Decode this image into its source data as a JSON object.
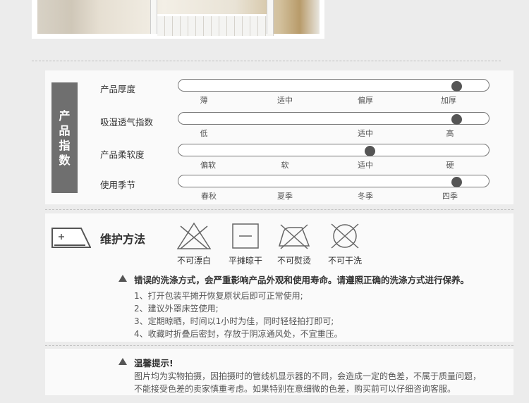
{
  "indices": {
    "sidebar_chars": [
      "产",
      "品",
      "指",
      "数"
    ],
    "rows": [
      {
        "label": "产品厚度",
        "ticks": [
          "薄",
          "适中",
          "偏厚",
          "加厚"
        ],
        "selected": 3,
        "level": 0.88
      },
      {
        "label": "吸湿透气指数",
        "ticks": [
          "低",
          "适中",
          "高"
        ],
        "selected": 2,
        "level": 0.88
      },
      {
        "label": "产品柔软度",
        "ticks": [
          "偏软",
          "软",
          "适中",
          "硬"
        ],
        "selected": 2,
        "level": 0.6
      },
      {
        "label": "使用季节",
        "ticks": [
          "春秋",
          "夏季",
          "冬季",
          "四季"
        ],
        "selected": 3,
        "level": 0.88
      }
    ]
  },
  "care": {
    "title": "维护方法",
    "symbols": [
      {
        "icon": "no-bleach-icon",
        "label": "不可漂白"
      },
      {
        "icon": "dry-flat-icon",
        "label": "平摊晾干"
      },
      {
        "icon": "no-iron-icon",
        "label": "不可熨烫"
      },
      {
        "icon": "no-wash-icon",
        "label": "不可干洗"
      }
    ],
    "warning": "错误的洗涤方式，会严重影响产品外观和使用寿命。请遵照正确的洗涤方式进行保养。",
    "steps": [
      "1、打开包装平摊开恢复原状后即可正常使用;",
      "2、建议外罩床笠使用;",
      "3、定期晾晒，时间以1小时为佳，同时轻轻拍打即可;",
      "4、收藏时折叠后密封，存放于阴凉通风处，不宜重压。"
    ]
  },
  "notice": {
    "title": "温馨提示!",
    "lines": [
      "图片均为实物拍摄，因拍摄时的管线机显示器的不同，会造成一定的色差，不属于质量问题，",
      "不能接受色差的卖家慎重考虑。如果特别在意细微的色差，购买前可以仔细咨询客服。"
    ]
  },
  "colors": {
    "sidebar": "#6f6f6f",
    "knob": "#555555",
    "background": "#ececec"
  }
}
